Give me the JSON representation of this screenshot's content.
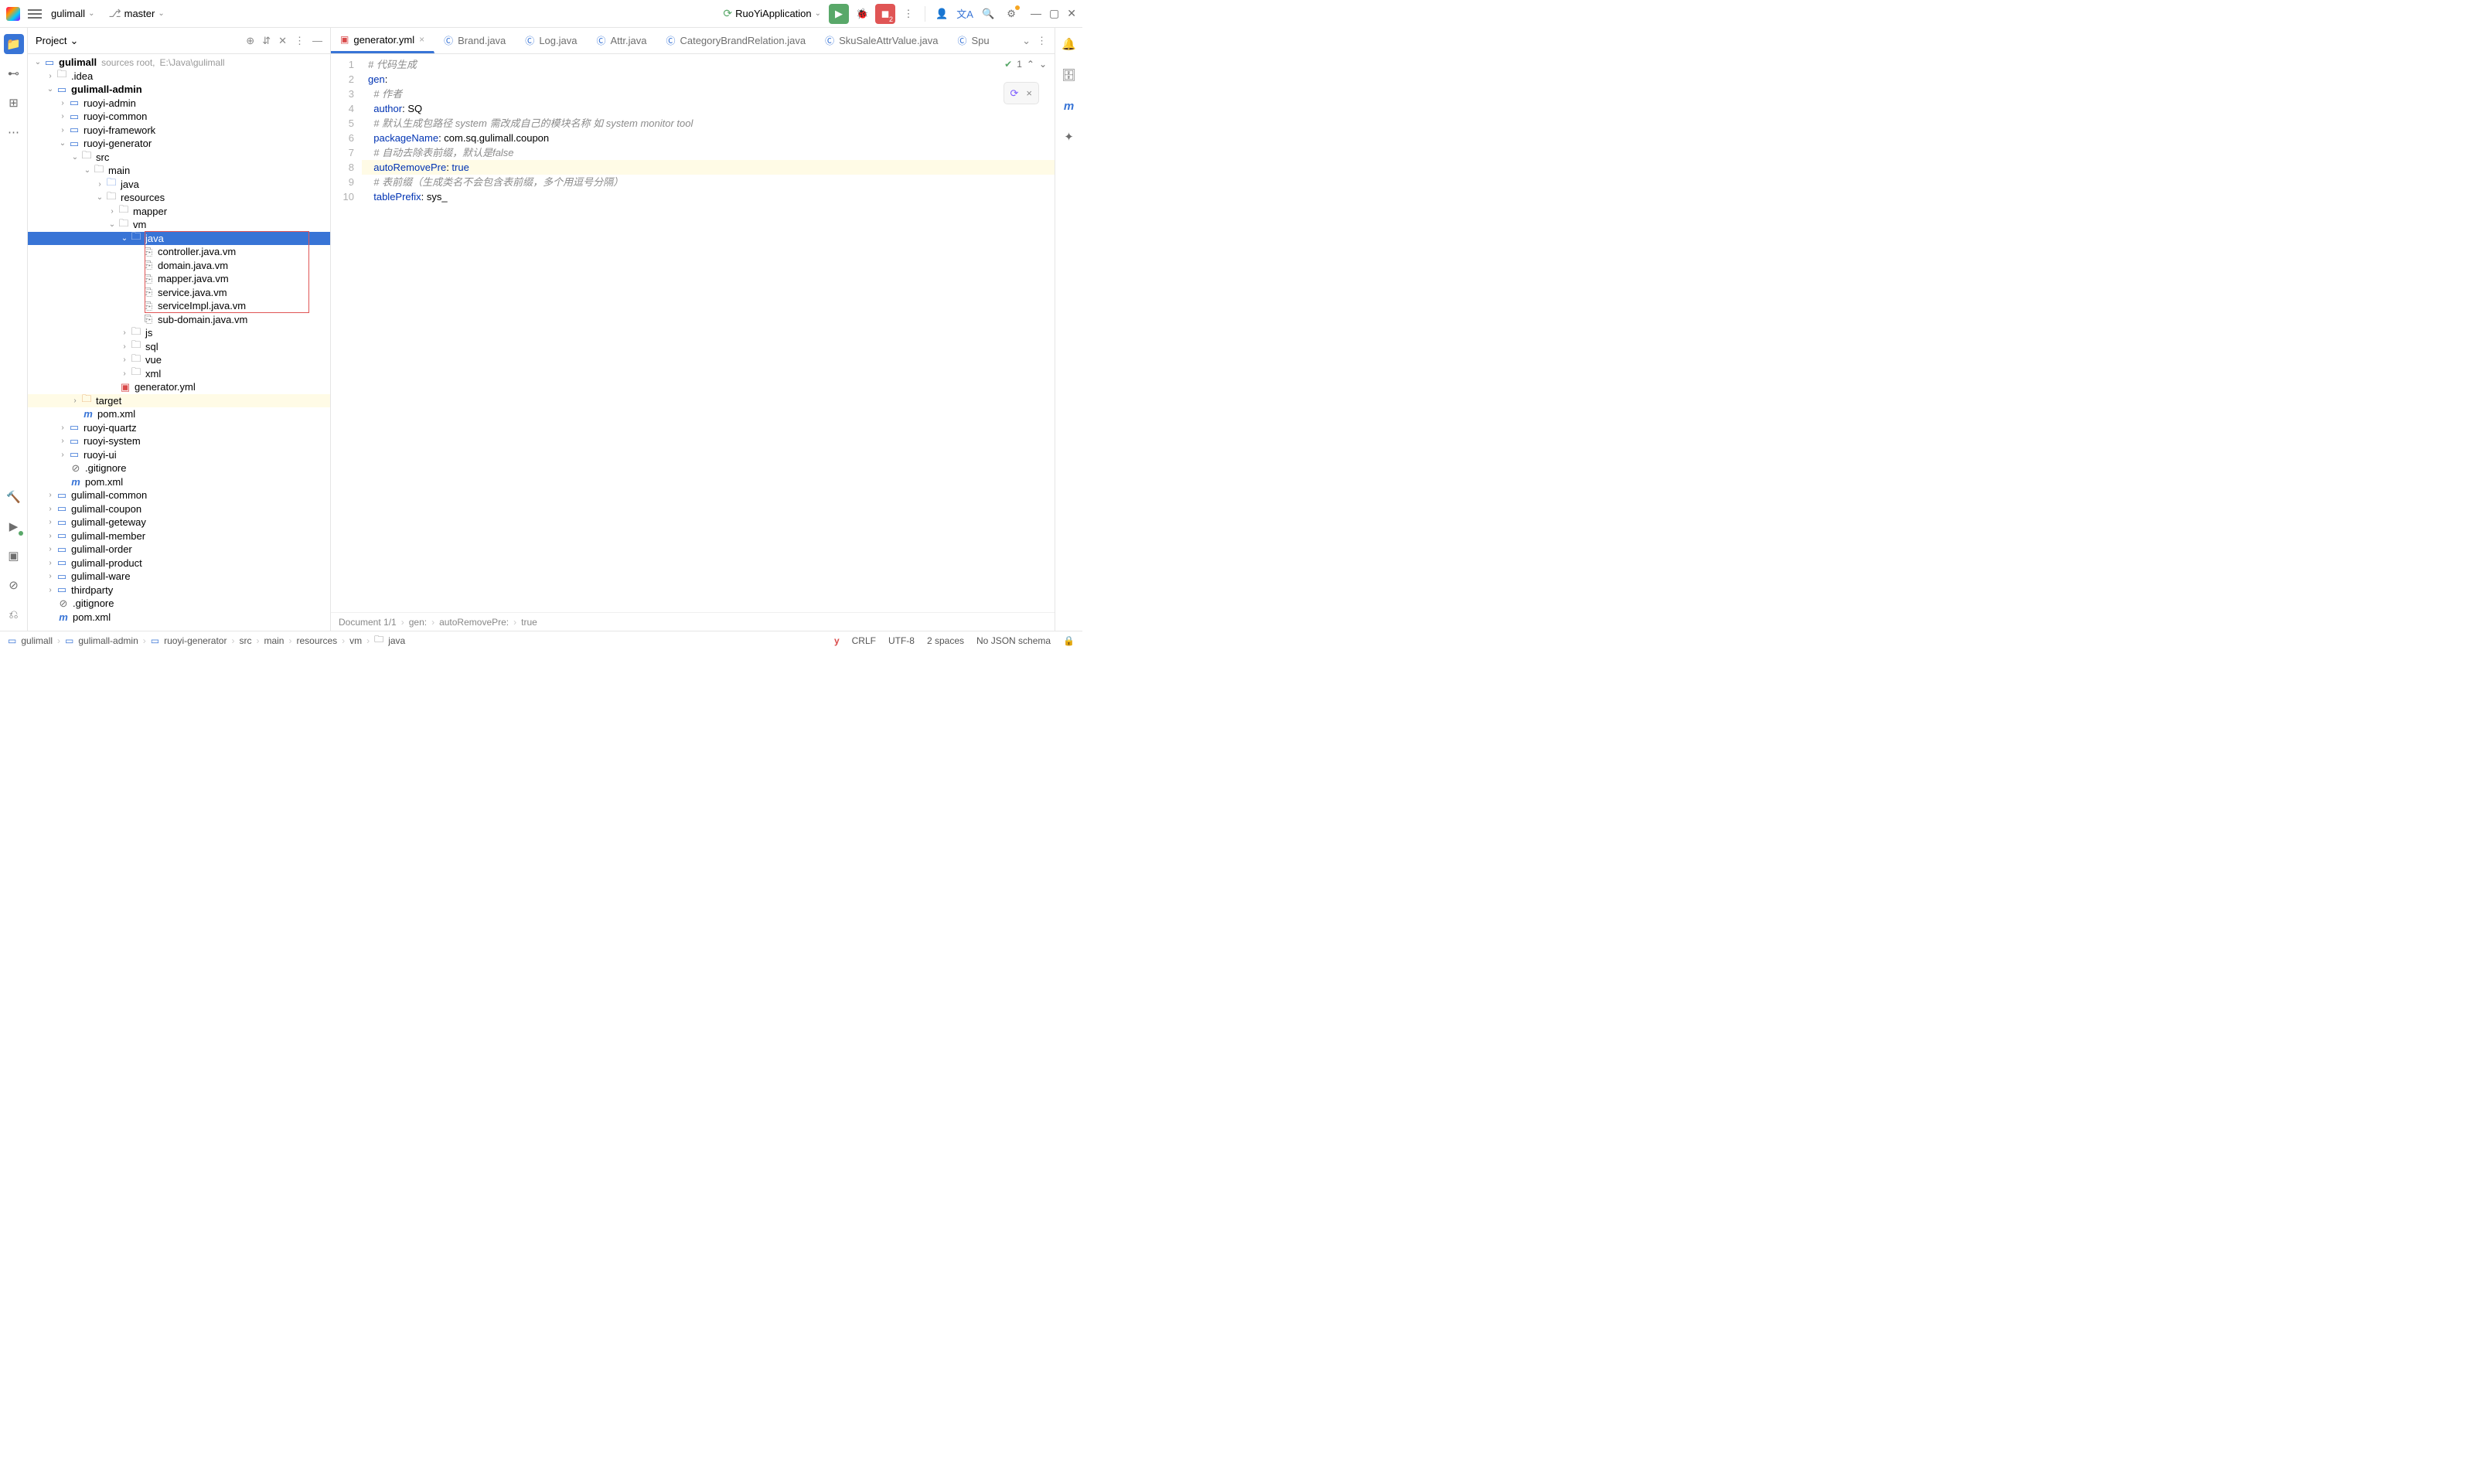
{
  "topbar": {
    "project": "gulimall",
    "branch": "master",
    "run_config": "RuoYiApplication",
    "stop_badge": "2"
  },
  "panel": {
    "title": "Project"
  },
  "tree": {
    "root": "gulimall",
    "root_extra_1": "sources root,",
    "root_extra_2": "E:\\Java\\gulimall",
    "idea": ".idea",
    "admin": "gulimall-admin",
    "ruoyi_admin": "ruoyi-admin",
    "ruoyi_common": "ruoyi-common",
    "ruoyi_framework": "ruoyi-framework",
    "ruoyi_generator": "ruoyi-generator",
    "src": "src",
    "main_dir": "main",
    "java_pkg": "java",
    "resources": "resources",
    "mapper": "mapper",
    "vm": "vm",
    "java_folder": "java",
    "controller_vm": "controller.java.vm",
    "domain_vm": "domain.java.vm",
    "mapper_vm": "mapper.java.vm",
    "service_vm": "service.java.vm",
    "serviceimpl_vm": "serviceImpl.java.vm",
    "subdomain_vm": "sub-domain.java.vm",
    "js": "js",
    "sql": "sql",
    "vue": "vue",
    "xml": "xml",
    "generator_yml": "generator.yml",
    "target": "target",
    "pom": "pom.xml",
    "ruoyi_quartz": "ruoyi-quartz",
    "ruoyi_system": "ruoyi-system",
    "ruoyi_ui": "ruoyi-ui",
    "gitignore": ".gitignore",
    "common": "gulimall-common",
    "coupon": "gulimall-coupon",
    "geteway": "gulimall-geteway",
    "member": "gulimall-member",
    "order": "gulimall-order",
    "product": "gulimall-product",
    "ware": "gulimall-ware",
    "thirdparty": "thirdparty"
  },
  "tabs": {
    "t1": "generator.yml",
    "t2": "Brand.java",
    "t3": "Log.java",
    "t4": "Attr.java",
    "t5": "CategoryBrandRelation.java",
    "t6": "SkuSaleAttrValue.java",
    "t7": "Spu"
  },
  "marker": {
    "count": "1"
  },
  "code": {
    "l1": "# 代码生成",
    "l2k": "gen",
    "l3": "# 作者",
    "l4k": "author",
    "l4v": "SQ",
    "l5": "# 默认生成包路径 system 需改成自己的模块名称 如 system monitor tool",
    "l6k": "packageName",
    "l6v": "com.sq.gulimall.coupon",
    "l7a": "# 自动去除表前缀，默认是",
    "l7b": "false",
    "l8k": "autoRemovePre",
    "l8v": "true",
    "l9": "# 表前缀（生成类名不会包含表前缀，多个用逗号分隔）",
    "l10k": "tablePrefix",
    "l10v": "sys_"
  },
  "breadcrumb": {
    "b1": "Document 1/1",
    "b2": "gen:",
    "b3": "autoRemovePre:",
    "b4": "true"
  },
  "status": {
    "p1": "gulimall",
    "p2": "gulimall-admin",
    "p3": "ruoyi-generator",
    "p4": "src",
    "p5": "main",
    "p6": "resources",
    "p7": "vm",
    "p8": "java",
    "crlf": "CRLF",
    "enc": "UTF-8",
    "indent": "2 spaces",
    "schema": "No JSON schema"
  }
}
